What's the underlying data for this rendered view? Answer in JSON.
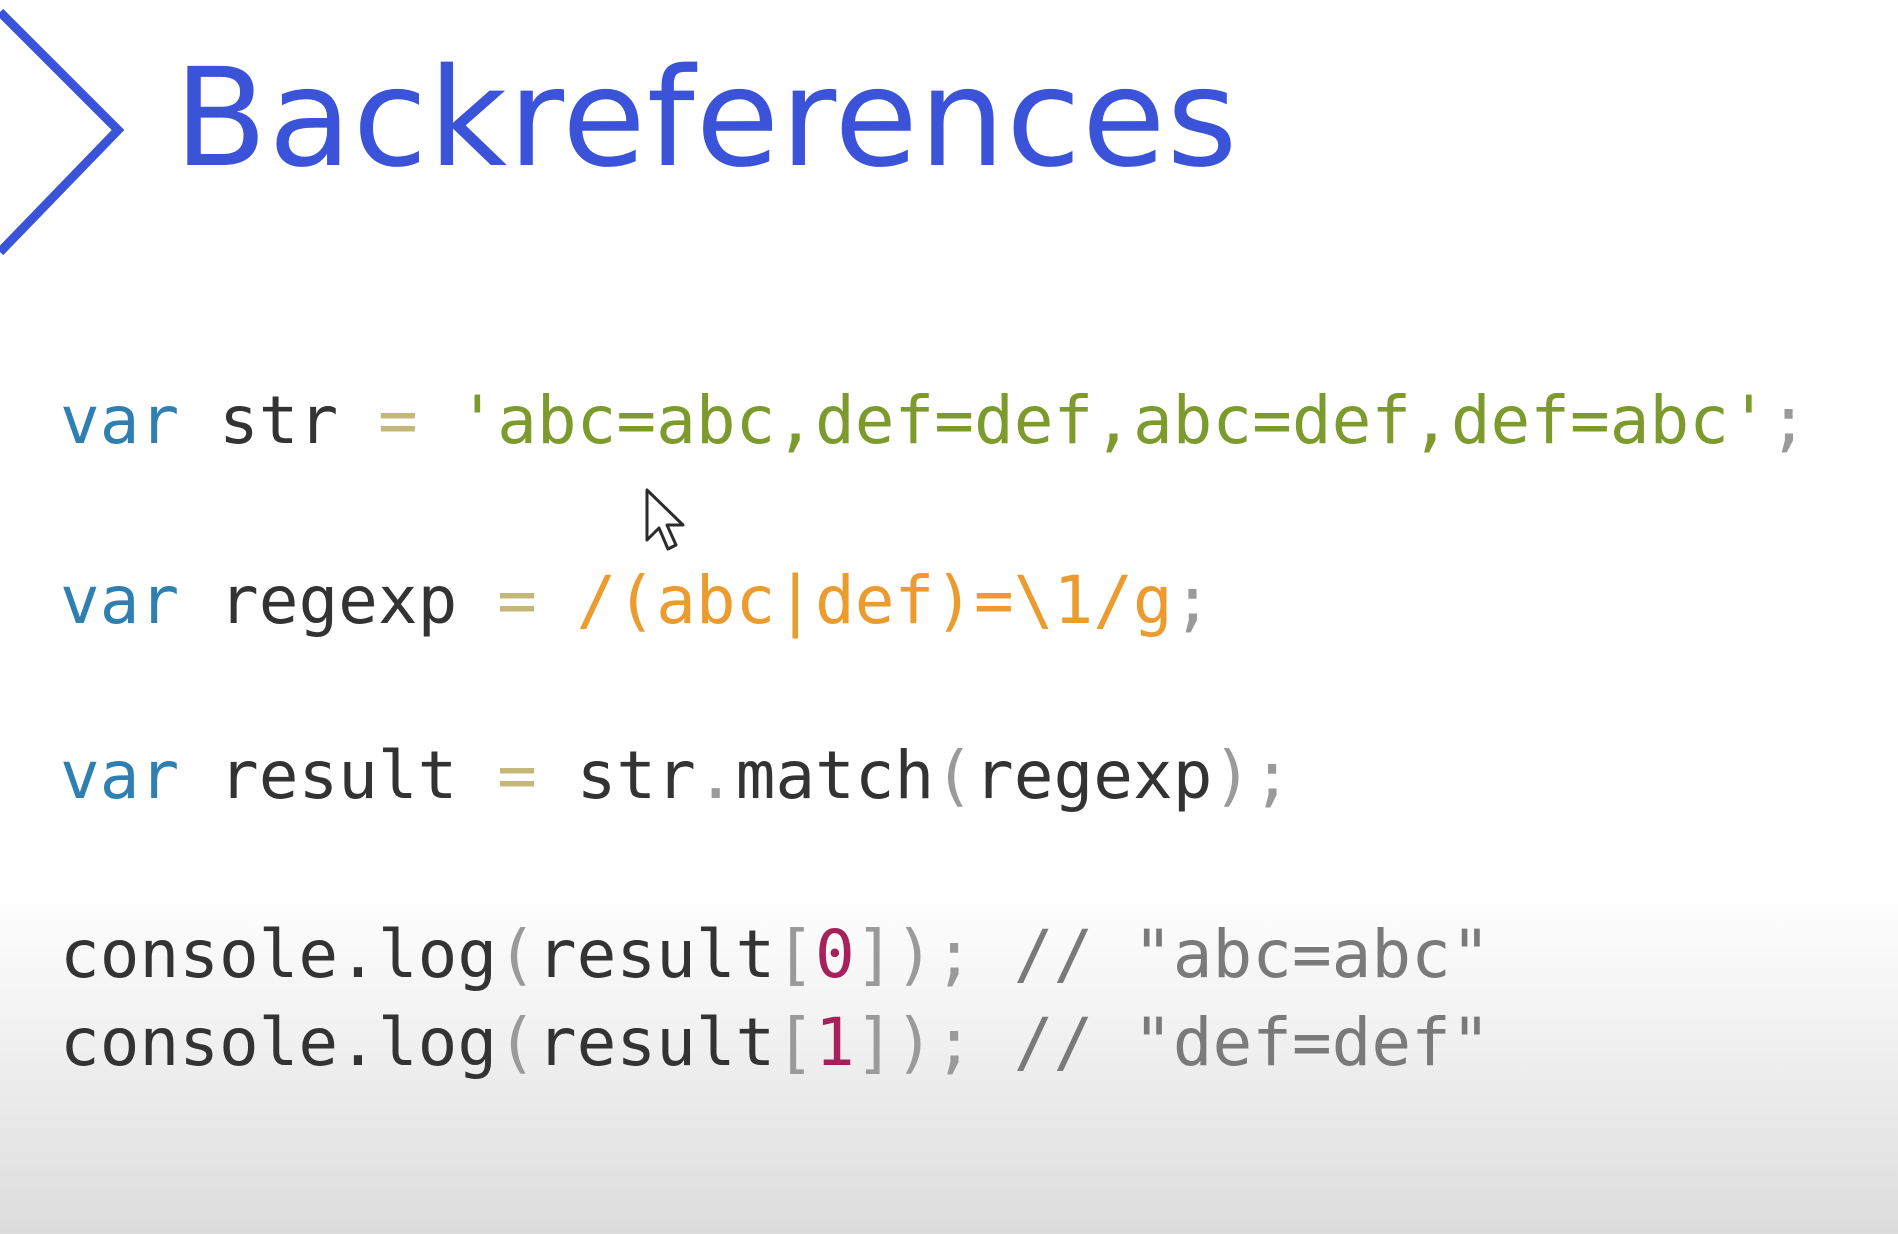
{
  "slide": {
    "title": "Backreferences"
  },
  "code": {
    "line1": {
      "keyword": "var",
      "name": "str",
      "assign": "=",
      "literal": "'abc=abc,def=def,abc=def,def=abc'",
      "semi": ";"
    },
    "line2": {
      "keyword": "var",
      "name": "regexp",
      "assign": "=",
      "literal": "/(abc|def)=\\1/g",
      "semi": ";"
    },
    "line3": {
      "keyword": "var",
      "name": "result",
      "assign": "=",
      "object": "str",
      "dot": ".",
      "method": "match",
      "open_paren": "(",
      "arg": "regexp",
      "close_paren": ")",
      "semi": ";"
    },
    "line4": {
      "object": "console",
      "dot": ".",
      "method": "log",
      "open_paren": "(",
      "arg": "result",
      "open_bracket": "[",
      "index": "0",
      "close_bracket": "]",
      "close_paren": ")",
      "semi": ";",
      "comment": "// \"abc=abc\""
    },
    "line5": {
      "object": "console",
      "dot": ".",
      "method": "log",
      "open_paren": "(",
      "arg": "result",
      "open_bracket": "[",
      "index": "1",
      "close_bracket": "]",
      "close_paren": ")",
      "semi": ";",
      "comment": "// \"def=def\""
    }
  },
  "icons": {
    "chevron": "chevron-right-icon",
    "cursor": "mouse-pointer-icon"
  },
  "colors": {
    "title": "#3a53d9",
    "keyword": "#2f7fb0",
    "string": "#7c9b2c",
    "regex": "#ec9b2f",
    "number": "#a6215b"
  }
}
